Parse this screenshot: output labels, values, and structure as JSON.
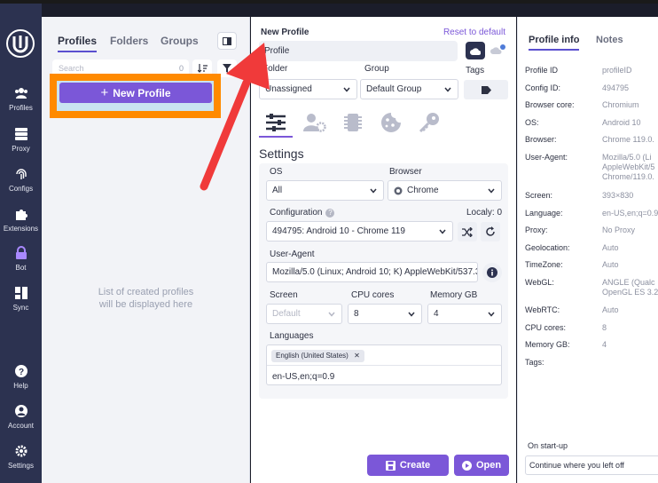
{
  "nav": {
    "items": [
      {
        "label": "Profiles",
        "icon": "users-icon"
      },
      {
        "label": "Proxy",
        "icon": "server-icon"
      },
      {
        "label": "Configs",
        "icon": "fingerprint-icon"
      },
      {
        "label": "Extensions",
        "icon": "puzzle-icon"
      },
      {
        "label": "Bot",
        "icon": "lock-icon"
      },
      {
        "label": "Sync",
        "icon": "sync-icon"
      },
      {
        "label": "Help",
        "icon": "help-icon"
      },
      {
        "label": "Account",
        "icon": "account-icon"
      },
      {
        "label": "Settings",
        "icon": "gear-icon"
      }
    ]
  },
  "list": {
    "tabs": [
      "Profiles",
      "Folders",
      "Groups"
    ],
    "search_placeholder": "Search",
    "count": "0",
    "new_profile_label": "New Profile",
    "empty_line1": "List of created profiles",
    "empty_line2": "will be displayed here"
  },
  "form": {
    "title": "New Profile",
    "reset_label": "Reset to default",
    "name_value": "Profile",
    "folder_label": "Folder",
    "folder_value": "Unassigned",
    "group_label": "Group",
    "group_value": "Default Group",
    "tags_label": "Tags",
    "settings_heading": "Settings",
    "os_label": "OS",
    "os_value": "All",
    "browser_label": "Browser",
    "browser_value": "Chrome",
    "config_label": "Configuration",
    "locally_label": "Localy: 0",
    "config_value": "494795: Android 10 - Chrome 119",
    "ua_label": "User-Agent",
    "ua_value": "Mozilla/5.0 (Linux; Android 10; K) AppleWebKit/537.3",
    "screen_label": "Screen",
    "screen_value": "Default",
    "cpu_label": "CPU cores",
    "cpu_value": "8",
    "memory_label": "Memory GB",
    "memory_value": "4",
    "languages_label": "Languages",
    "language_chip": "English (United States)",
    "languages_value": "en-US,en;q=0.9",
    "create_label": "Create",
    "open_label": "Open"
  },
  "info": {
    "tabs": [
      "Profile info",
      "Notes"
    ],
    "rows": [
      {
        "k": "Profile ID",
        "v": "profileID"
      },
      {
        "k": "Config ID:",
        "v": "494795"
      },
      {
        "k": "Browser core:",
        "v": "Chromium"
      },
      {
        "k": "OS:",
        "v": "Android 10"
      },
      {
        "k": "Browser:",
        "v": "Chrome 119.0."
      },
      {
        "k": "User-Agent:",
        "v": "Mozilla/5.0 (Li\nAppleWebKit/5\nChrome/119.0."
      },
      {
        "k": "Screen:",
        "v": "393×830"
      },
      {
        "k": "Language:",
        "v": "en-US,en;q=0.9"
      },
      {
        "k": "Proxy:",
        "v": "No Proxy"
      },
      {
        "k": "Geolocation:",
        "v": "Auto"
      },
      {
        "k": "TimeZone:",
        "v": "Auto"
      },
      {
        "k": "WebGL:",
        "v": "ANGLE (Qualc\nOpenGL ES 3.2"
      },
      {
        "k": "WebRTC:",
        "v": "Auto"
      },
      {
        "k": "CPU cores:",
        "v": "8"
      },
      {
        "k": "Memory GB:",
        "v": "4"
      },
      {
        "k": "Tags:",
        "v": ""
      }
    ],
    "startup_label": "On start-up",
    "startup_value": "Continue where you left off"
  },
  "colors": {
    "accent": "#7b57d8",
    "nav_bg": "#2c3250",
    "highlight": "#ff8a00",
    "arrow": "#f03a3a"
  }
}
